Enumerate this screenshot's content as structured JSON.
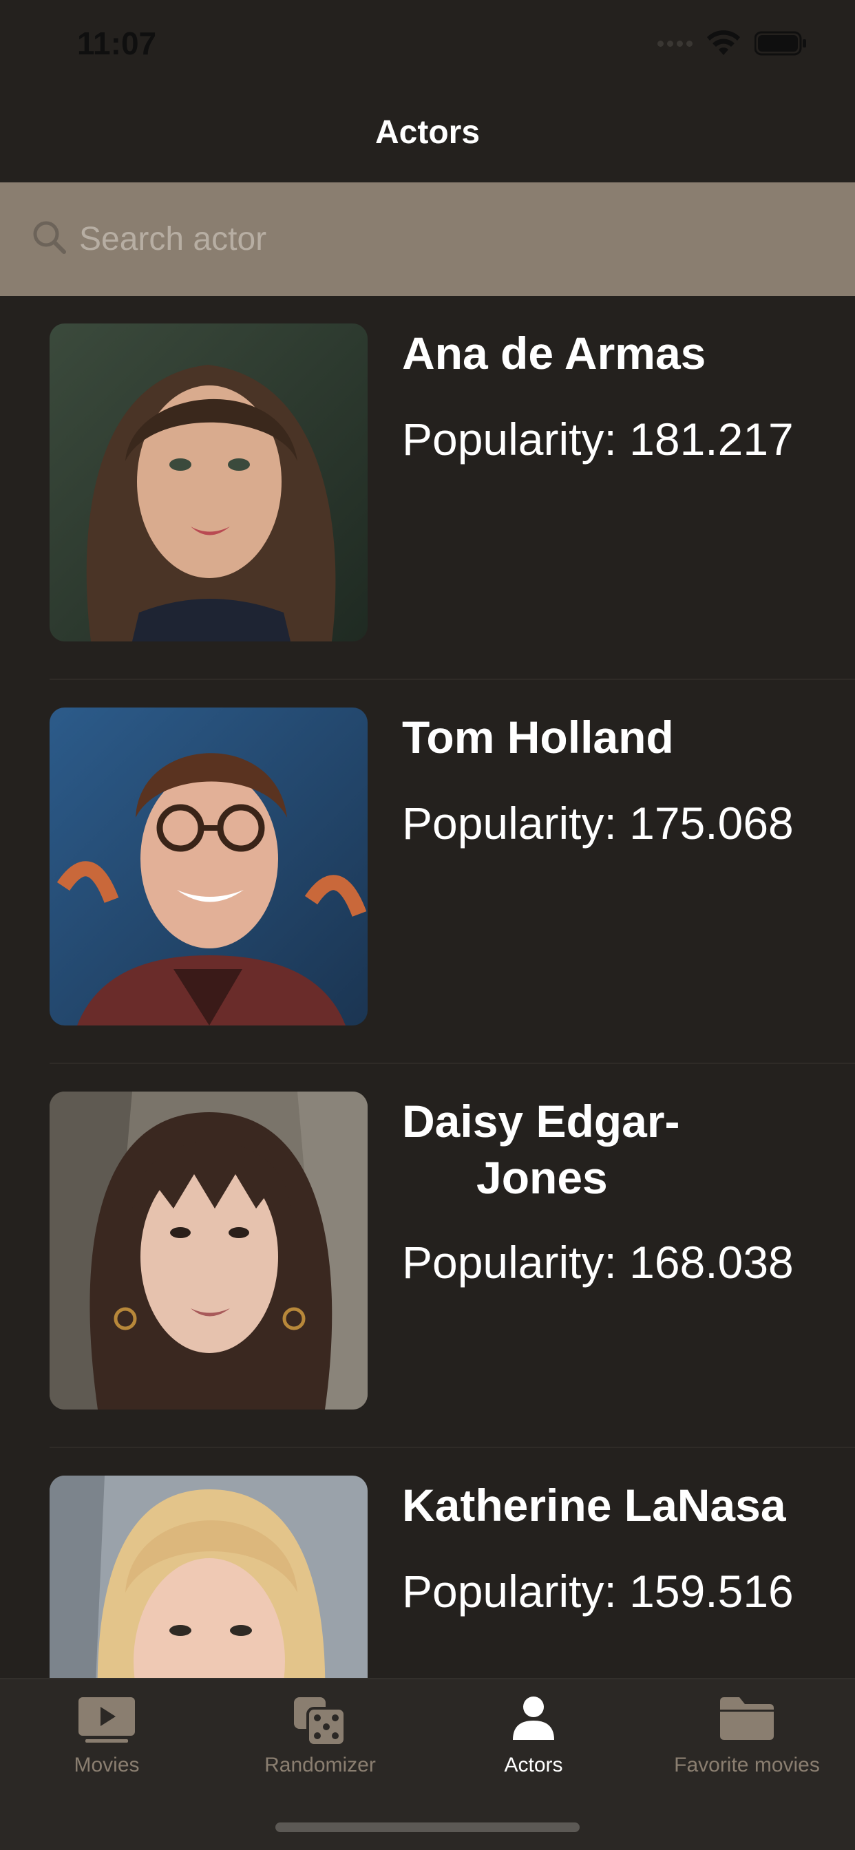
{
  "status_bar": {
    "time": "11:07"
  },
  "nav": {
    "title": "Actors"
  },
  "search": {
    "placeholder": "Search actor",
    "value": ""
  },
  "actors": [
    {
      "name": "Ana de Armas",
      "popularity": "Popularity: 181.217"
    },
    {
      "name": "Tom Holland",
      "popularity": "Popularity: 175.068"
    },
    {
      "name_line1": "Daisy Edgar-",
      "name_line2": "Jones",
      "popularity": "Popularity: 168.038"
    },
    {
      "name": "Katherine LaNasa",
      "popularity": "Popularity: 159.516"
    }
  ],
  "tab_bar": {
    "tabs": [
      {
        "label": "Movies",
        "icon": "play-icon",
        "active": false
      },
      {
        "label": "Randomizer",
        "icon": "dice-icon",
        "active": false
      },
      {
        "label": "Actors",
        "icon": "person-icon",
        "active": true
      },
      {
        "label": "Favorite movies",
        "icon": "folder-icon",
        "active": false
      }
    ]
  },
  "colors": {
    "background": "#24211e",
    "search_bar": "#8a7e70",
    "tab_inactive": "#8a7e70",
    "tab_active": "#ffffff"
  }
}
